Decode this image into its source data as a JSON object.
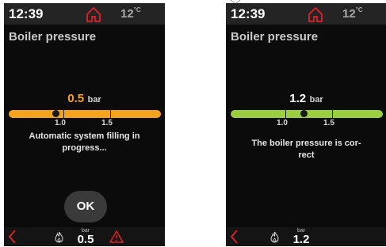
{
  "colors": {
    "accent_red": "#e2202b",
    "gauge_orange": "#f5a31c",
    "gauge_green": "#9ccf3f",
    "value_orange": "#f5a31c"
  },
  "screens": [
    {
      "status_bar": {
        "time": "12:39",
        "outdoor_temp": "12",
        "temp_unit": "°C",
        "home_icon": "home-icon"
      },
      "title": "Boiler pressure",
      "readout": {
        "value": "0.5",
        "unit": "bar"
      },
      "gauge": {
        "current": 0.5,
        "ticks": [
          "1.0",
          "1.5"
        ],
        "state": "low"
      },
      "message": "Automatic system filling in progress...",
      "ok_label": "OK",
      "bottom_bar": {
        "pressure_unit": "bar",
        "pressure_value": "0.5",
        "warning": true
      }
    },
    {
      "status_bar": {
        "time": "12:39",
        "outdoor_temp": "12",
        "temp_unit": "°C",
        "home_icon": "home-icon"
      },
      "title": "Boiler pressure",
      "readout": {
        "value": "1.2",
        "unit": "bar"
      },
      "gauge": {
        "current": 1.2,
        "ticks": [
          "1.0",
          "1.5"
        ],
        "state": "normal"
      },
      "message": "The boiler pressure is cor-\nrect",
      "bottom_bar": {
        "pressure_unit": "bar",
        "pressure_value": "1.2",
        "warning": false
      }
    }
  ]
}
